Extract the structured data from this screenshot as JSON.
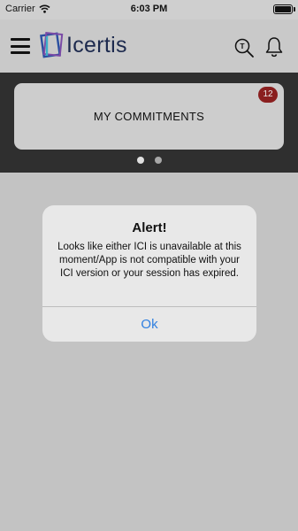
{
  "status_bar": {
    "carrier": "Carrier",
    "time": "6:03 PM"
  },
  "header": {
    "logo_text": "Icertis",
    "search_icon_letter": "T"
  },
  "carousel": {
    "card_title": "MY COMMITMENTS",
    "badge_count": "12",
    "page_count": 2,
    "active_page": 1
  },
  "alert": {
    "title": "Alert!",
    "message": "Looks like either ICI is unavailable at this moment/App is not compatible with your ICI version or your session has expired.",
    "ok_label": "Ok"
  },
  "colors": {
    "badge": "#8a1f1f",
    "ok_link": "#2f7fe0",
    "logo_blue": "#2a4fa0",
    "logo_purple": "#7a4aa6",
    "logo_teal": "#3ab0c9"
  }
}
